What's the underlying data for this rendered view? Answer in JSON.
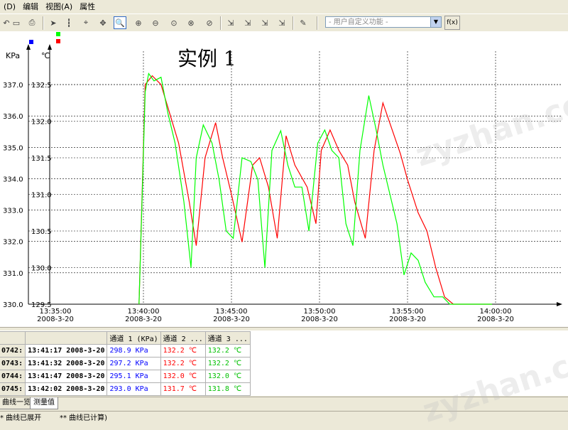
{
  "menu": [
    "(D)",
    "编辑",
    "视图(A)",
    "属性"
  ],
  "toolbar": {
    "icons": [
      "arrow-icon",
      "folder-open-icon",
      "print-icon",
      "pointer-icon",
      "cursor-line-icon",
      "cursor-cross-icon",
      "pan-icon",
      "zoom-icon",
      "zoom-in-icon",
      "zoom-out-icon",
      "zoom-x-icon",
      "zoom-y-icon",
      "zoom-reset-icon",
      "curve-a-icon",
      "curve-b-icon",
      "curve-c-icon",
      "curve-d-icon",
      "pen-icon"
    ],
    "function_placeholder": "- 用户自定义功能 -",
    "fx_label": "f(x)"
  },
  "colors": {
    "kpa_series": "#ff0000",
    "temp_series": "#00ff00",
    "kpa_marker": "#0000ff",
    "temp_marker": "#ff0000"
  },
  "chart_data": {
    "type": "line",
    "title": "实例 1",
    "left_axis": {
      "unit": "KPa",
      "ylim": [
        330.0,
        337.0
      ],
      "ticks": [
        "330.0",
        "331.0",
        "332.0",
        "333.0",
        "334.0",
        "335.0",
        "336.0",
        "337.0"
      ]
    },
    "right_axis": {
      "unit": "℃",
      "ylim": [
        129.5,
        132.5
      ],
      "ticks": [
        "129.5",
        "130.0",
        "130.5",
        "131.0",
        "131.5",
        "132.0",
        "132.5"
      ]
    },
    "x_ticks": [
      {
        "time": "13:35:00",
        "date": "2008-3-20"
      },
      {
        "time": "13:40:00",
        "date": "2008-3-20"
      },
      {
        "time": "13:45:00",
        "date": "2008-3-20"
      },
      {
        "time": "13:50:00",
        "date": "2008-3-20"
      },
      {
        "time": "13:55:00",
        "date": "2008-3-20"
      },
      {
        "time": "14:00:00",
        "date": "2008-3-20"
      }
    ],
    "x_range_minutes": [
      0,
      25
    ],
    "grid": true,
    "series": [
      {
        "axis": "right",
        "color": "#ff0000",
        "x": [
          4.75,
          5.1,
          5.5,
          6.0,
          6.5,
          7.0,
          7.6,
          8.0,
          8.5,
          9.1,
          9.5,
          10.0,
          10.6,
          11.2,
          11.6,
          12.1,
          12.6,
          13.1,
          13.6,
          14.3,
          14.8,
          15.1,
          15.6,
          16.1,
          16.6,
          17.0,
          17.6,
          18.1,
          18.6,
          19.1,
          19.6,
          20.0,
          20.6,
          21.1,
          21.6,
          22.1,
          22.6,
          23.1,
          23.6,
          24.0,
          24.5,
          24.8
        ],
        "y": [
          129.5,
          132.5,
          132.62,
          132.5,
          132.1,
          131.7,
          130.9,
          130.3,
          131.5,
          131.98,
          131.5,
          131.0,
          130.35,
          131.4,
          131.5,
          131.1,
          130.4,
          131.8,
          131.4,
          131.1,
          130.6,
          131.6,
          131.88,
          131.6,
          131.4,
          130.9,
          130.4,
          131.6,
          132.25,
          131.9,
          131.55,
          131.2,
          130.75,
          130.5,
          130.0,
          129.6,
          129.5,
          129.5,
          129.5,
          129.5,
          129.5,
          129.5
        ]
      },
      {
        "axis": "right",
        "color": "#00ff00",
        "x": [
          4.75,
          5.1,
          5.3,
          5.6,
          6.0,
          6.4,
          6.8,
          7.3,
          7.7,
          8.0,
          8.4,
          8.9,
          9.3,
          9.7,
          10.1,
          10.6,
          11.1,
          11.5,
          11.9,
          12.3,
          12.8,
          13.2,
          13.6,
          14.0,
          14.4,
          14.9,
          15.3,
          15.7,
          16.1,
          16.5,
          16.9,
          17.3,
          17.8,
          18.2,
          18.6,
          19.0,
          19.4,
          19.8,
          20.2,
          20.6,
          21.0,
          21.5,
          22.0,
          22.4,
          22.8,
          23.2,
          23.6,
          24.0,
          24.4,
          24.8
        ],
        "y": [
          129.5,
          132.4,
          132.65,
          132.55,
          132.6,
          132.1,
          131.7,
          130.9,
          130.0,
          131.5,
          131.95,
          131.7,
          131.2,
          130.5,
          130.4,
          131.5,
          131.45,
          131.2,
          130.0,
          131.6,
          131.87,
          131.4,
          131.1,
          131.1,
          130.5,
          131.7,
          131.88,
          131.6,
          131.5,
          130.6,
          130.3,
          131.6,
          132.35,
          131.9,
          131.4,
          131.0,
          130.6,
          129.9,
          130.2,
          130.1,
          129.8,
          129.6,
          129.6,
          129.5,
          129.5,
          129.5,
          129.5,
          129.5,
          129.5,
          129.5
        ]
      }
    ]
  },
  "table": {
    "headers": [
      "",
      "",
      "通道 1 (KPa)",
      "通道 2 ...",
      "通道 3 ..."
    ],
    "rows": [
      {
        "idx": "0742:",
        "time": "13:41:17 2008-3-20",
        "ch1": "298.9 KPa",
        "ch2": "132.2 ℃",
        "ch3": "132.2 ℃"
      },
      {
        "idx": "0743:",
        "time": "13:41:32 2008-3-20",
        "ch1": "297.2 KPa",
        "ch2": "132.2 ℃",
        "ch3": "132.2 ℃"
      },
      {
        "idx": "0744:",
        "time": "13:41:47 2008-3-20",
        "ch1": "295.1 KPa",
        "ch2": "132.0 ℃",
        "ch3": "132.0 ℃"
      },
      {
        "idx": "0745:",
        "time": "13:42:02 2008-3-20",
        "ch1": "293.0 KPa",
        "ch2": "131.7 ℃",
        "ch3": "131.8 ℃"
      }
    ]
  },
  "tabs": [
    "曲线一览",
    "测量值"
  ],
  "status": [
    "* 曲线已展开",
    "** 曲线已计算)"
  ],
  "watermark": "zyzhan.com"
}
